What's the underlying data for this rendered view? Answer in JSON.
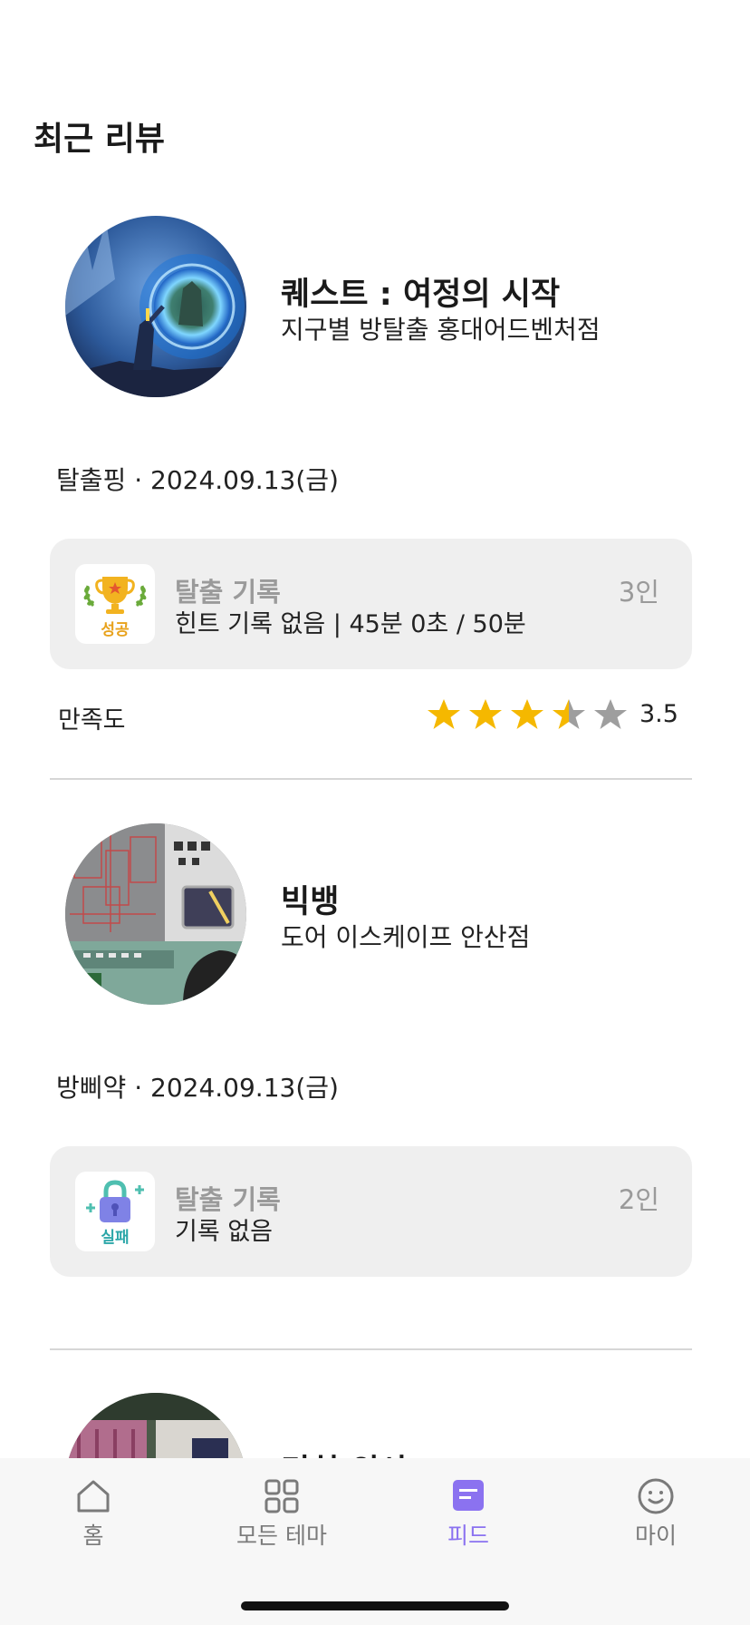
{
  "page": {
    "title": "최근 리뷰"
  },
  "reviews": [
    {
      "theme_name": "퀘스트 : 여정의 시작",
      "store": "지구별 방탈출 홍대어드벤처점",
      "nickname": "탈출핑",
      "date": "2024.09.13(금)",
      "record": {
        "title": "탈출 기록",
        "result": "성공",
        "detail": "힌트 기록 없음 | 45분 0초 / 50분",
        "people": "3인"
      },
      "satisfaction_label": "만족도",
      "rating": 3.5,
      "rating_text": "3.5"
    },
    {
      "theme_name": "빅뱅",
      "store": "도어 이스케이프 안산점",
      "nickname": "방삐약",
      "date": "2024.09.13(금)",
      "record": {
        "title": "탈출 기록",
        "result": "실패",
        "detail": "기록 없음",
        "people": "2인"
      }
    },
    {
      "theme_name": "미친 의사"
    }
  ],
  "tabbar": {
    "items": [
      {
        "label": "홈",
        "icon": "home-icon"
      },
      {
        "label": "모든 테마",
        "icon": "grid-icon"
      },
      {
        "label": "피드",
        "icon": "feed-icon"
      },
      {
        "label": "마이",
        "icon": "smile-icon"
      }
    ],
    "active_index": 2
  },
  "colors": {
    "accent": "#8b72f0",
    "star_filled": "#f5b800",
    "star_empty": "#9e9e9e",
    "success": "#e8a21c",
    "fail": "#2aa6a8"
  }
}
